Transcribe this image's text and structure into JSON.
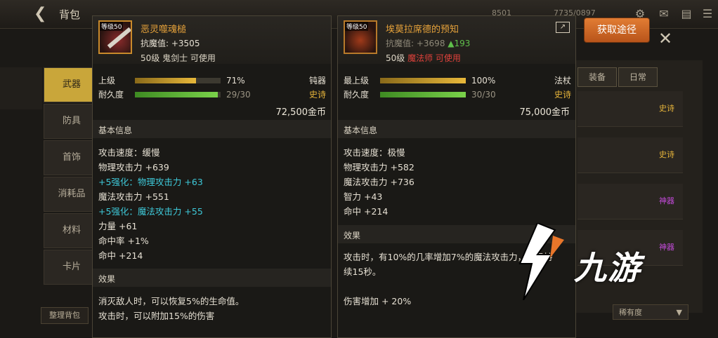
{
  "topbar": {
    "title": "背包",
    "back_icon": "arrow-left-icon",
    "stat_a": "8501",
    "stat_b": "7735/0897"
  },
  "sidebar": {
    "tabs": [
      {
        "label": "武器",
        "active": true
      },
      {
        "label": "防具",
        "active": false
      },
      {
        "label": "首饰",
        "active": false
      },
      {
        "label": "消耗品",
        "active": false
      },
      {
        "label": "材料",
        "active": false
      },
      {
        "label": "卡片",
        "active": false
      }
    ],
    "bottom_button": "整理背包"
  },
  "right_panel": {
    "tabs": [
      "装备",
      "日常"
    ],
    "rows": [
      {
        "label": "史诗",
        "color": "#e6b43a"
      },
      {
        "label": "史诗",
        "color": "#e6b43a"
      },
      {
        "label": "神器",
        "color": "#c04ad6"
      },
      {
        "label": "神器",
        "color": "#c04ad6"
      }
    ],
    "sort_label": "稀有度",
    "sort_arrow": "▼"
  },
  "get_button": "获取途径",
  "close_icon": "close-icon",
  "left_card": {
    "name": "恶灵噬魂槌",
    "level_badge": "等级50",
    "resist_label": "抗魔值: +3505",
    "usage": "50级 鬼剑士 可使用",
    "grade_label": "上级",
    "grade_percent": "71%",
    "grade_fraction": 0.71,
    "type": "钝器",
    "durability_label": "耐久度",
    "durability_value": "29/30",
    "durability_fraction": 0.966,
    "rarity": "史诗",
    "price": "72,500金币",
    "basic_info": "基本信息",
    "stats": [
      {
        "text": "攻击速度：缓慢",
        "style": "normal"
      },
      {
        "text": "物理攻击力 +639",
        "style": "normal"
      },
      {
        "text": "+5强化：物理攻击力 +63",
        "style": "cyan"
      },
      {
        "text": "魔法攻击力 +551",
        "style": "normal"
      },
      {
        "text": "+5强化：魔法攻击力 +55",
        "style": "cyan"
      },
      {
        "text": "力量 +61",
        "style": "normal"
      },
      {
        "text": "命中率 +1%",
        "style": "normal"
      },
      {
        "text": "命中 +214",
        "style": "normal"
      }
    ],
    "effect_head": "效果",
    "effects": [
      "消灭敌人时，可以恢复5%的生命值。",
      "攻击时，可以附加15%的伤害"
    ]
  },
  "right_card": {
    "name": "埃莫拉席德的预知",
    "level_badge": "等级50",
    "resist_label": "抗魔值: +3698",
    "resist_delta": "▲193",
    "usage_level": "50级",
    "usage_class": "魔法师 可使用",
    "grade_label": "最上级",
    "grade_percent": "100%",
    "grade_fraction": 1.0,
    "type": "法杖",
    "durability_label": "耐久度",
    "durability_value": "30/30",
    "durability_fraction": 1.0,
    "rarity": "史诗",
    "price": "75,000金币",
    "basic_info": "基本信息",
    "stats": [
      {
        "text": "攻击速度：极慢",
        "style": "normal"
      },
      {
        "text": "物理攻击力 +582",
        "style": "normal"
      },
      {
        "text": "魔法攻击力 +736",
        "style": "normal"
      },
      {
        "text": "智力 +43",
        "style": "normal"
      },
      {
        "text": "命中 +214",
        "style": "normal"
      }
    ],
    "effect_head": "效果",
    "effects": [
      "攻击时，有10%的几率增加7%的魔法攻击力，效果持",
      "续15秒。",
      "伤害增加 + 20%"
    ]
  },
  "watermark": {
    "text": "九游"
  },
  "colors": {
    "accent_orange": "#d0692a",
    "epic": "#e6b43a",
    "enhance_cyan": "#3ec9d9",
    "grade_bar": "#d6a62a",
    "durability_bar": "#6cc23a"
  }
}
